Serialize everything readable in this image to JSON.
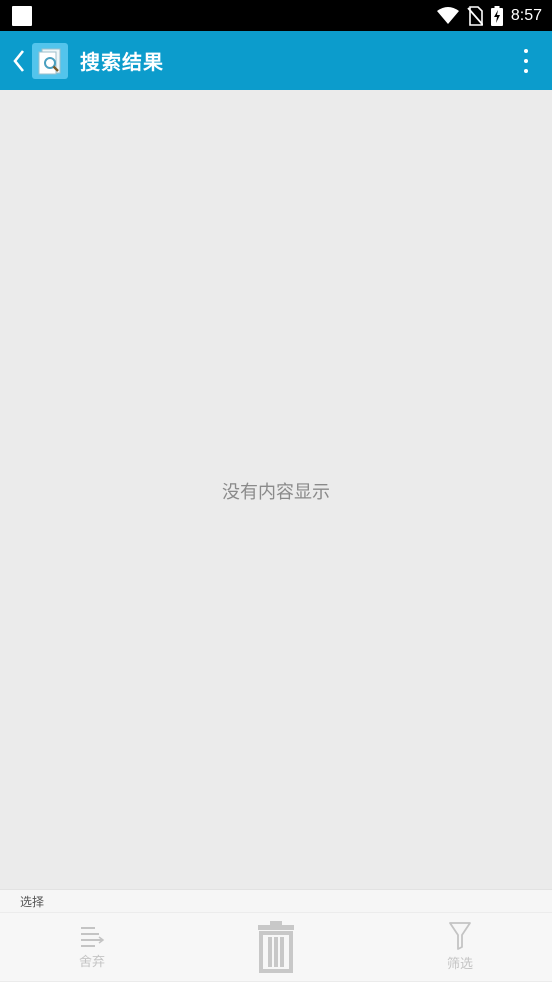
{
  "status_bar": {
    "time": "8:57",
    "icons": [
      "notification-square-icon",
      "wifi-icon",
      "no-sim-icon",
      "battery-charging-icon"
    ]
  },
  "app_bar": {
    "title": "搜索结果",
    "back_icon": "chevron-left-icon",
    "app_icon": "document-search-icon",
    "overflow_icon": "more-vertical-icon",
    "background_color": "#0c9ccc"
  },
  "content": {
    "empty_message": "没有内容显示"
  },
  "selection_bar": {
    "label": "选择"
  },
  "bottom_bar": {
    "discard_label": "舍弃",
    "delete_icon": "trash-icon",
    "filter_label": "筛选"
  }
}
